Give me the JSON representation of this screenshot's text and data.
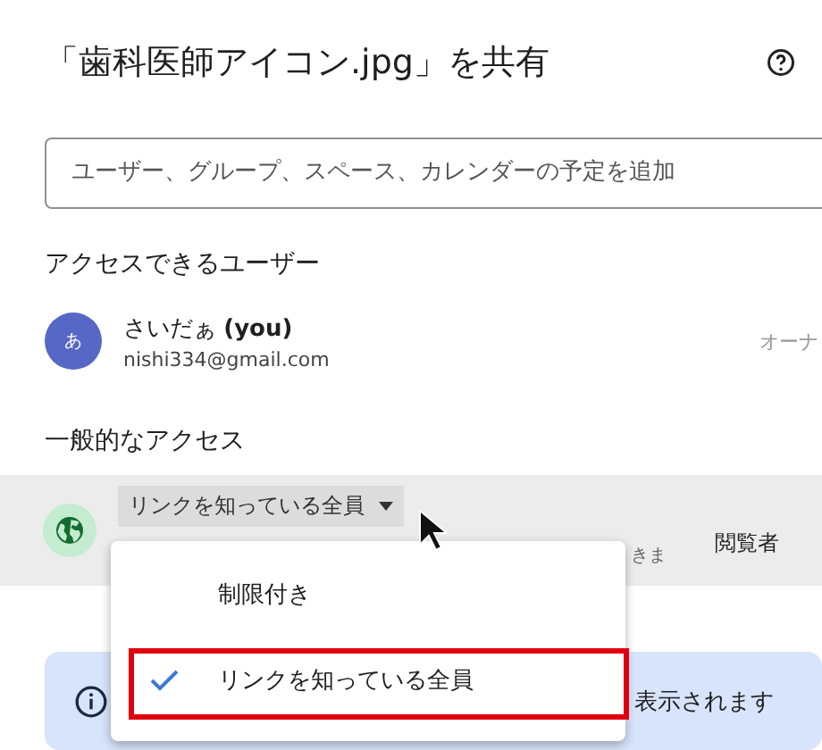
{
  "dialog": {
    "title": "「歯科医師アイコン.jpg」を共有"
  },
  "add_people": {
    "placeholder": "ユーザー、グループ、スペース、カレンダーの予定を追加"
  },
  "people_section": {
    "heading": "アクセスできるユーザー",
    "people": [
      {
        "avatar": "あ",
        "name": "さいだぁ",
        "suffix": "(you)",
        "email": "nishi334@gmail.com",
        "role": "オーナ"
      }
    ]
  },
  "general_access": {
    "heading": "一般的なアクセス",
    "scope": "リンクを知っている全員",
    "description": "きま",
    "role": "閲覧者",
    "menu": [
      {
        "label": "制限付き",
        "selected": false
      },
      {
        "label": "リンクを知っている全員",
        "selected": true
      }
    ]
  },
  "info_banner": {
    "text": "表示されます"
  }
}
